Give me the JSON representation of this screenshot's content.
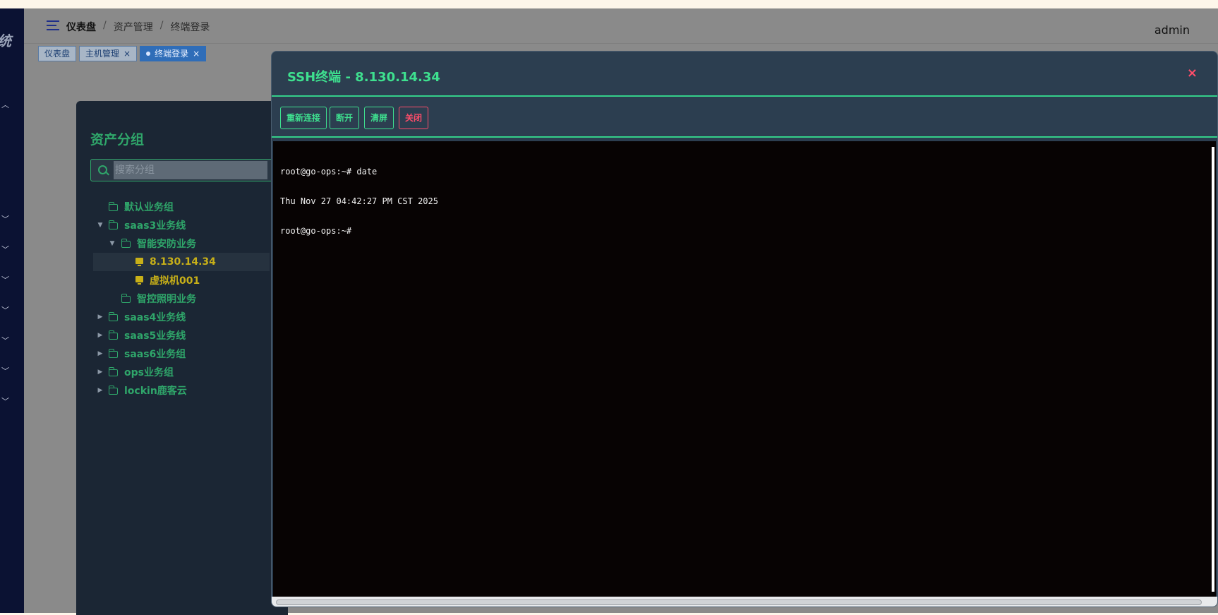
{
  "sidebar": {
    "brand": "统"
  },
  "header": {
    "breadcrumb": [
      "仪表盘",
      "资产管理",
      "终端登录"
    ],
    "user": "admin"
  },
  "tabs": [
    {
      "label": "仪表盘",
      "closable": false,
      "active": false
    },
    {
      "label": "主机管理",
      "closable": true,
      "active": false
    },
    {
      "label": "终端登录",
      "closable": true,
      "active": true
    }
  ],
  "panel": {
    "title": "资产分组",
    "search_placeholder": "搜索分组",
    "tree": [
      {
        "label": "默认业务组",
        "type": "folder",
        "depth": 0
      },
      {
        "label": "saas3业务线",
        "type": "folder",
        "depth": 0,
        "expanded": true
      },
      {
        "label": "智能安防业务",
        "type": "folder",
        "depth": 1,
        "expanded": true
      },
      {
        "label": "8.130.14.34",
        "type": "host",
        "depth": 2,
        "selected": true
      },
      {
        "label": "虚拟机001",
        "type": "host",
        "depth": 2
      },
      {
        "label": "智控照明业务",
        "type": "folder",
        "depth": 1
      },
      {
        "label": "saas4业务线",
        "type": "folder",
        "depth": 0,
        "expanded": false
      },
      {
        "label": "saas5业务线",
        "type": "folder",
        "depth": 0,
        "expanded": false
      },
      {
        "label": "saas6业务组",
        "type": "folder",
        "depth": 0,
        "expanded": false
      },
      {
        "label": "ops业务组",
        "type": "folder",
        "depth": 0,
        "expanded": false
      },
      {
        "label": "lockin鹿客云",
        "type": "folder",
        "depth": 0,
        "expanded": false
      }
    ]
  },
  "modal": {
    "title": "SSH终端 - 8.130.14.34",
    "close_symbol": "×",
    "buttons": {
      "reconnect": "重新连接",
      "disconnect": "断开",
      "clear": "清屏",
      "close": "关闭"
    },
    "terminal_lines": [
      "root@go-ops:~# date",
      "Thu Nov 27 04:42:27 PM CST 2025",
      "root@go-ops:~# "
    ]
  },
  "colors": {
    "accent_green": "#3ee08f",
    "danger_red": "#ff4d6a",
    "host_yellow": "#c8b018"
  }
}
